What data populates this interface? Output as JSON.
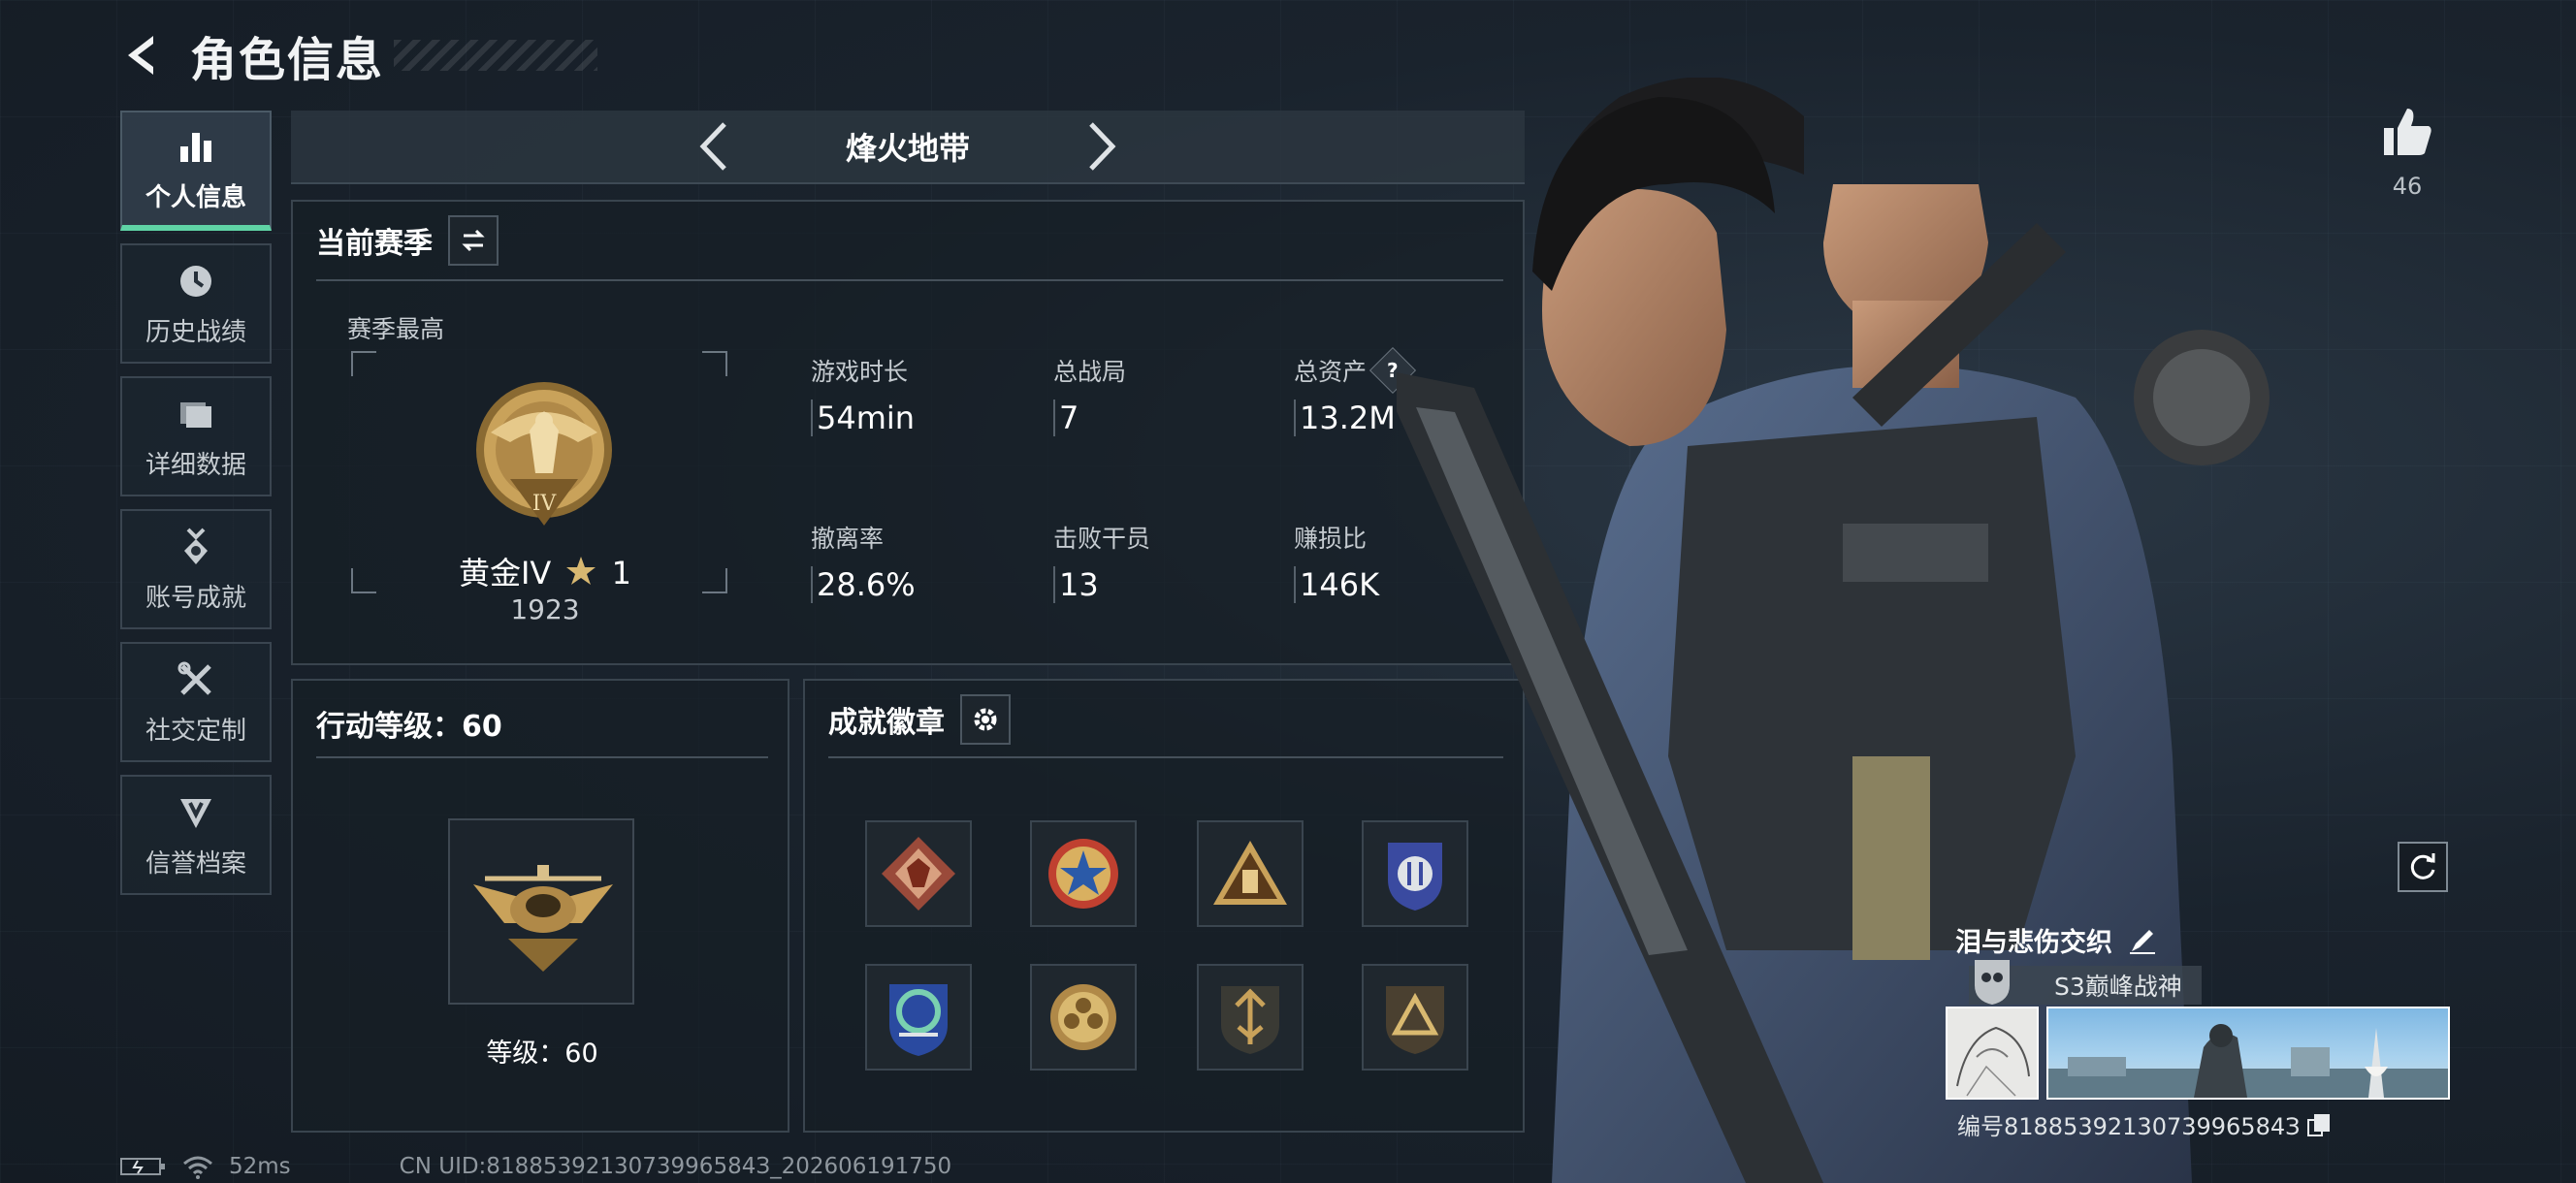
{
  "header": {
    "title": "角色信息"
  },
  "sidebar": {
    "items": [
      {
        "label": "个人信息",
        "icon": "bar-chart-icon",
        "active": true
      },
      {
        "label": "历史战绩",
        "icon": "clock-icon"
      },
      {
        "label": "详细数据",
        "icon": "folder-icon"
      },
      {
        "label": "账号成就",
        "icon": "medal-icon"
      },
      {
        "label": "社交定制",
        "icon": "wrench-icon"
      },
      {
        "label": "信誉档案",
        "icon": "shield-icon"
      }
    ]
  },
  "mode_bar": {
    "title": "烽火地带"
  },
  "season": {
    "title": "当前赛季",
    "best_label": "赛季最高",
    "rank_name": "黄金IV",
    "rank_stars": "1",
    "rank_score": "1923",
    "rank_numeral": "IV",
    "stats": [
      {
        "label": "游戏时长",
        "value": "54min"
      },
      {
        "label": "总战局",
        "value": "7"
      },
      {
        "label": "总资产",
        "value": "13.2M",
        "help": "?"
      },
      {
        "label": "撤离率",
        "value": "28.6%"
      },
      {
        "label": "击败干员",
        "value": "13"
      },
      {
        "label": "赚损比",
        "value": "146K"
      }
    ]
  },
  "action_level": {
    "title": "行动等级：60",
    "level_text": "等级：60"
  },
  "achievements": {
    "title": "成就徽章",
    "badges": [
      {
        "icon": "dragon-badge-icon"
      },
      {
        "icon": "star-emblem-badge-icon"
      },
      {
        "icon": "triangle-bag-badge-icon"
      },
      {
        "icon": "police-shield-badge-icon"
      },
      {
        "icon": "recycle-shield-badge-icon"
      },
      {
        "icon": "flower-coin-badge-icon"
      },
      {
        "icon": "arrow-shield-badge-icon"
      },
      {
        "icon": "triangle-shield-badge-icon"
      }
    ]
  },
  "profile": {
    "likes": "46",
    "player_name": "泪与悲伤交织",
    "title_tag": "S3巅峰战神",
    "serial": "编号8188539213073996584З"
  },
  "footer": {
    "ping": "52ms",
    "uid": "CN UID:8188539213073996584З_202606191750"
  },
  "colors": {
    "accent": "#5fd3a5",
    "gold": "#c9a25a"
  }
}
